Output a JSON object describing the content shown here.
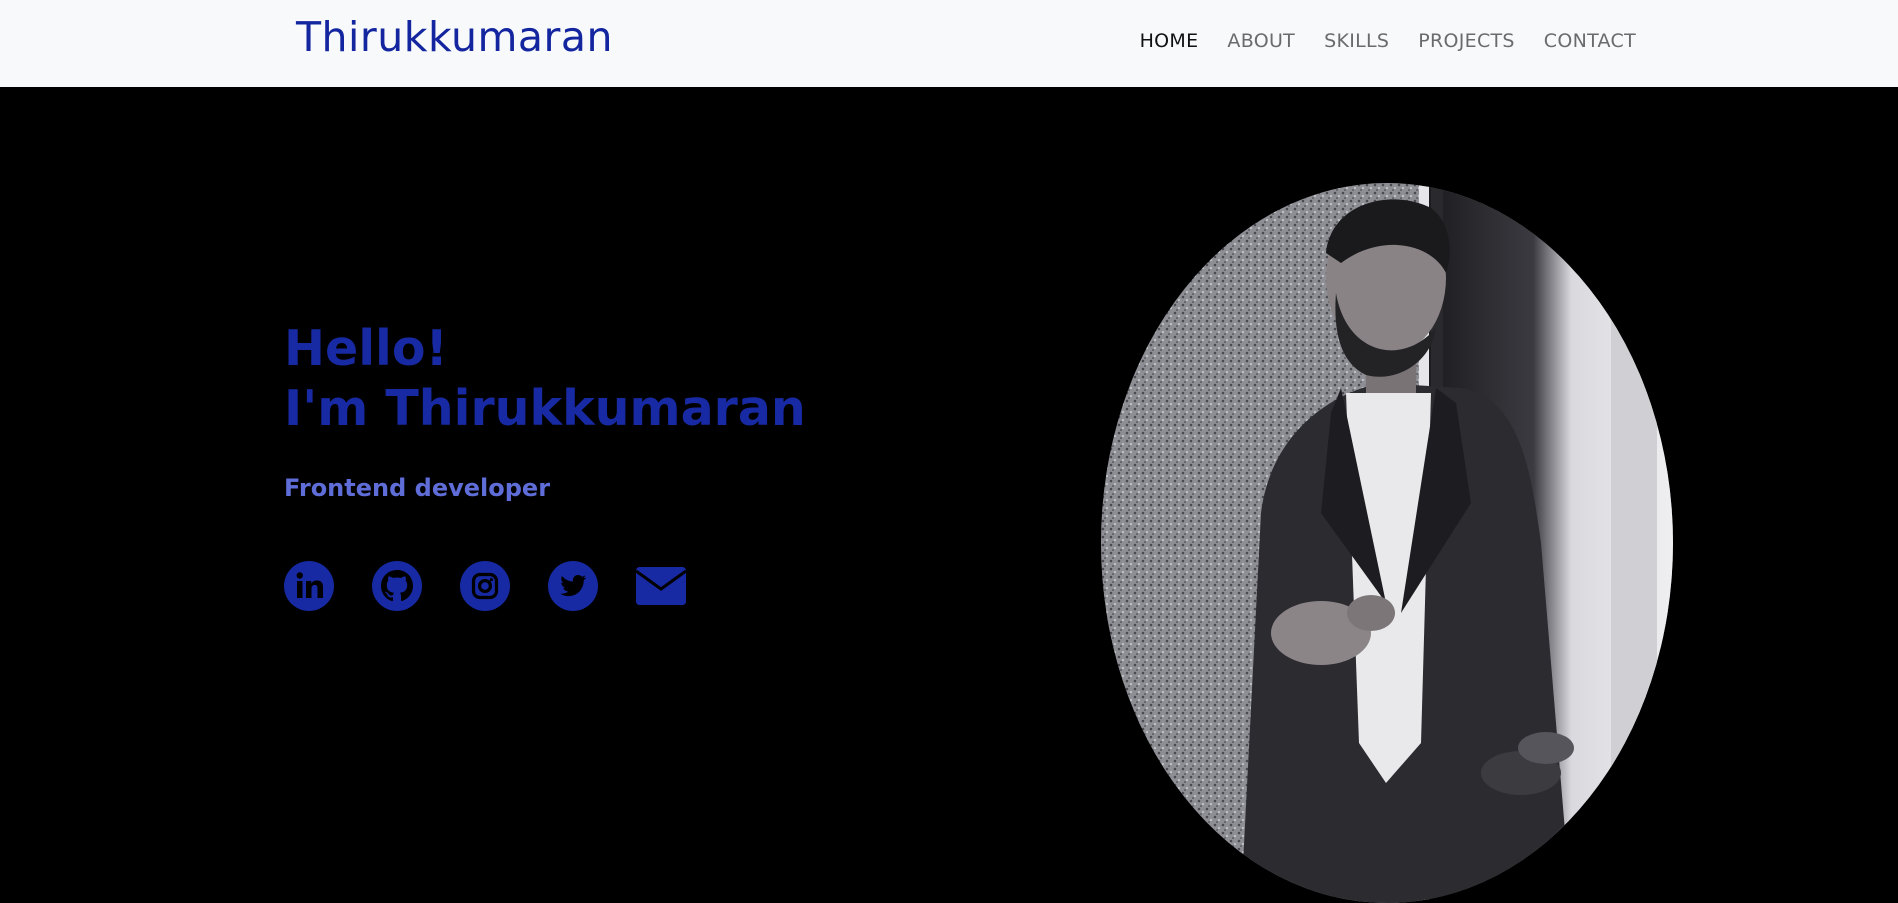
{
  "header": {
    "brand": "Thirukkumaran",
    "nav": [
      {
        "label": "HOME",
        "active": true
      },
      {
        "label": "ABOUT",
        "active": false
      },
      {
        "label": "SKILLS",
        "active": false
      },
      {
        "label": "PROJECTS",
        "active": false
      },
      {
        "label": "CONTACT",
        "active": false
      }
    ]
  },
  "hero": {
    "greeting_line1": "Hello!",
    "greeting_line2": "I'm Thirukkumaran",
    "role": "Frontend developer",
    "socials": [
      {
        "icon": "linkedin-icon"
      },
      {
        "icon": "github-icon"
      },
      {
        "icon": "instagram-icon"
      },
      {
        "icon": "twitter-icon"
      },
      {
        "icon": "email-icon"
      }
    ]
  },
  "colors": {
    "accent": "#172aa3",
    "role": "#5f6dd8",
    "navbar_bg": "#f8f9fb",
    "hero_bg": "#000000"
  }
}
